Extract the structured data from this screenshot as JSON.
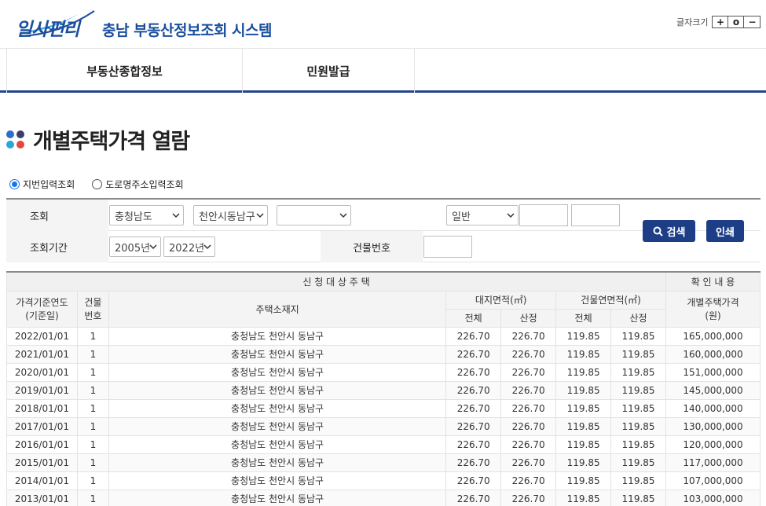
{
  "header": {
    "logo_text": "일사편리",
    "system_title": "충남 부동산정보조회 시스템",
    "font_size_label": "글자크기",
    "font_size_buttons": [
      "+",
      "o",
      "−"
    ]
  },
  "nav": {
    "items": [
      "부동산종합정보",
      "민원발급"
    ]
  },
  "page": {
    "title": "개별주택가격 열람"
  },
  "search_type": {
    "options": [
      {
        "label": "지번입력조회",
        "selected": true
      },
      {
        "label": "도로명주소입력조회",
        "selected": false
      }
    ]
  },
  "search_form": {
    "row1_label": "조회",
    "province": "충청남도",
    "city": "천안시동남구",
    "town": "",
    "land_type": "일반",
    "row2_label": "조회기간",
    "year_from": "2005년",
    "year_to": "2022년",
    "building_no_label": "건물번호",
    "search_button": "검색",
    "print_button": "인쇄"
  },
  "table": {
    "group_applicant": "신 청 대 상 주 택",
    "group_confirm": "확 인 내 용",
    "col_year": "가격기준연도\n(기준일)",
    "col_year_l1": "가격기준연도",
    "col_year_l2": "(기준일)",
    "col_bldg_l1": "건물",
    "col_bldg_l2": "번호",
    "col_address": "주택소재지",
    "col_land_area": "대지면적(㎡)",
    "col_bldg_area": "건물연면적(㎡)",
    "col_price_l1": "개별주택가격",
    "col_price_l2": "(원)",
    "sub_total": "전체",
    "sub_calc": "산정",
    "rows": [
      {
        "date": "2022/01/01",
        "bldg": "1",
        "address": "충청남도 천안시 동남구",
        "land_total": "226.70",
        "land_calc": "226.70",
        "bldg_total": "119.85",
        "bldg_calc": "119.85",
        "price": "165,000,000"
      },
      {
        "date": "2021/01/01",
        "bldg": "1",
        "address": "충청남도 천안시 동남구",
        "land_total": "226.70",
        "land_calc": "226.70",
        "bldg_total": "119.85",
        "bldg_calc": "119.85",
        "price": "160,000,000"
      },
      {
        "date": "2020/01/01",
        "bldg": "1",
        "address": "충청남도 천안시 동남구",
        "land_total": "226.70",
        "land_calc": "226.70",
        "bldg_total": "119.85",
        "bldg_calc": "119.85",
        "price": "151,000,000"
      },
      {
        "date": "2019/01/01",
        "bldg": "1",
        "address": "충청남도 천안시 동남구",
        "land_total": "226.70",
        "land_calc": "226.70",
        "bldg_total": "119.85",
        "bldg_calc": "119.85",
        "price": "145,000,000"
      },
      {
        "date": "2018/01/01",
        "bldg": "1",
        "address": "충청남도 천안시 동남구",
        "land_total": "226.70",
        "land_calc": "226.70",
        "bldg_total": "119.85",
        "bldg_calc": "119.85",
        "price": "140,000,000"
      },
      {
        "date": "2017/01/01",
        "bldg": "1",
        "address": "충청남도 천안시 동남구",
        "land_total": "226.70",
        "land_calc": "226.70",
        "bldg_total": "119.85",
        "bldg_calc": "119.85",
        "price": "130,000,000"
      },
      {
        "date": "2016/01/01",
        "bldg": "1",
        "address": "충청남도 천안시 동남구",
        "land_total": "226.70",
        "land_calc": "226.70",
        "bldg_total": "119.85",
        "bldg_calc": "119.85",
        "price": "120,000,000"
      },
      {
        "date": "2015/01/01",
        "bldg": "1",
        "address": "충청남도 천안시 동남구",
        "land_total": "226.70",
        "land_calc": "226.70",
        "bldg_total": "119.85",
        "bldg_calc": "119.85",
        "price": "117,000,000"
      },
      {
        "date": "2014/01/01",
        "bldg": "1",
        "address": "충청남도 천안시 동남구",
        "land_total": "226.70",
        "land_calc": "226.70",
        "bldg_total": "119.85",
        "bldg_calc": "119.85",
        "price": "107,000,000"
      },
      {
        "date": "2013/01/01",
        "bldg": "1",
        "address": "충청남도 천안시 동남구",
        "land_total": "226.70",
        "land_calc": "226.70",
        "bldg_total": "119.85",
        "bldg_calc": "119.85",
        "price": "103,000,000"
      }
    ]
  },
  "colors": {
    "brand_blue": "#1a4f9e",
    "nav_border": "#21468e",
    "button_navy": "#1d3e86"
  }
}
